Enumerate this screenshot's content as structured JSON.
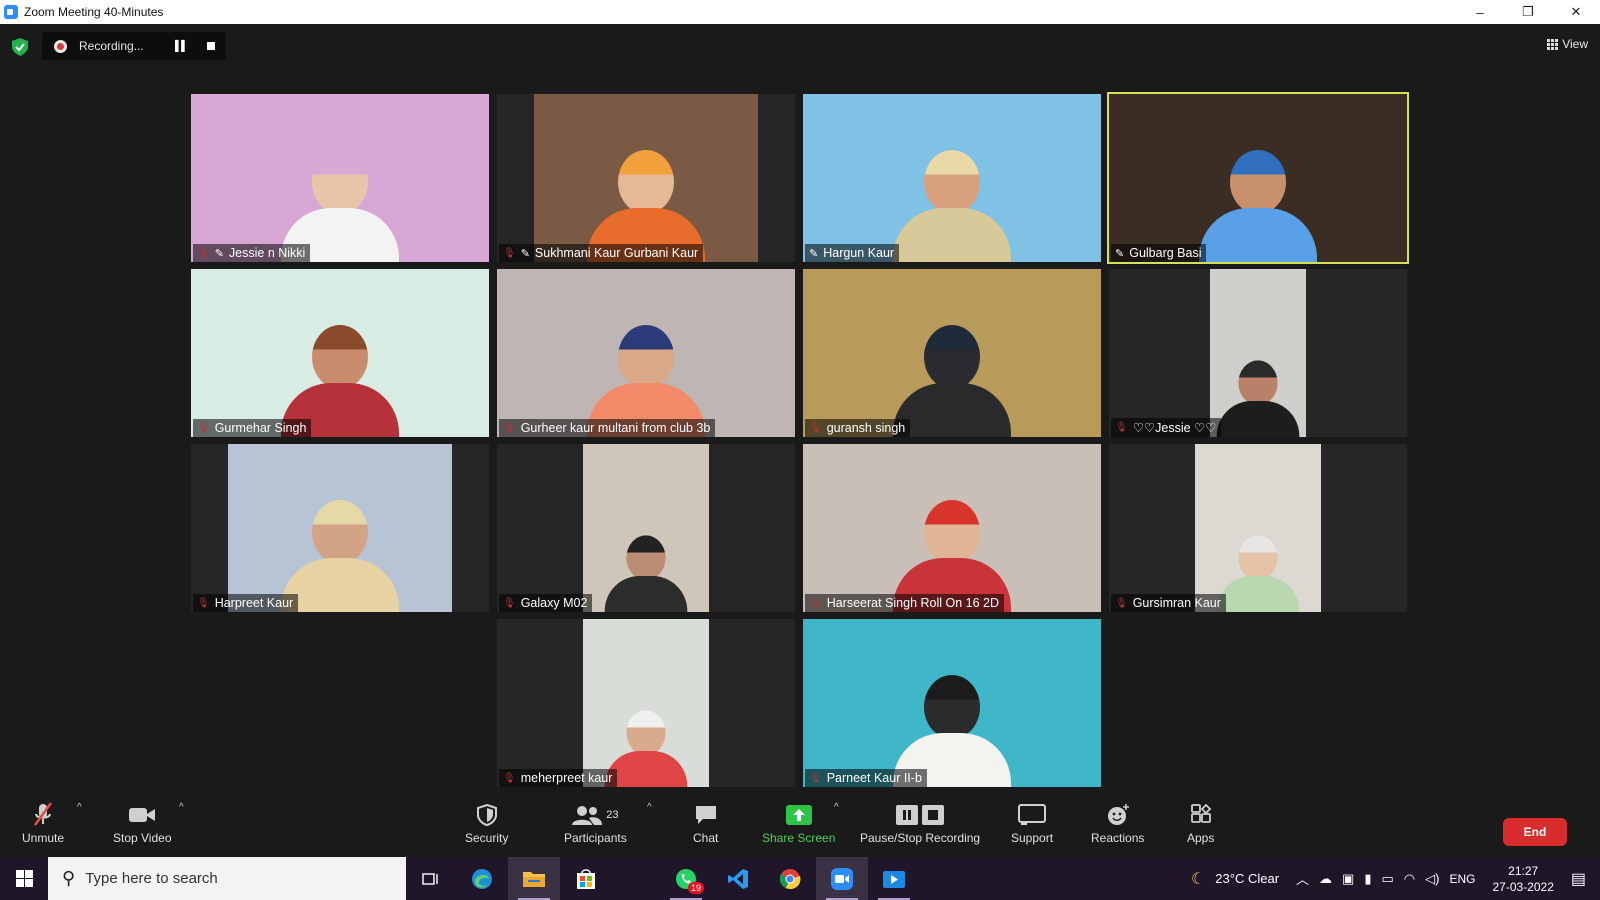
{
  "window": {
    "title": "Zoom Meeting 40-Minutes",
    "controls": [
      "–",
      "❐",
      "✕"
    ]
  },
  "meeting": {
    "recording_label": "Recording...",
    "view_label": "View",
    "participants": [
      {
        "name": "Jessie n Nikki",
        "muted": true,
        "pinned": true,
        "bg": "#d9a7d6"
      },
      {
        "name": "Sukhmani Kaur Gurbani Kaur",
        "muted": true,
        "pinned": true,
        "bg": "#7a5a45"
      },
      {
        "name": "Hargun Kaur",
        "muted": false,
        "pinned": true,
        "bg": "#7fc2e6"
      },
      {
        "name": "Gulbarg Basi",
        "muted": false,
        "pinned": true,
        "bg": "#3b2c24",
        "active_speaker": true
      },
      {
        "name": "Gurmehar Singh",
        "muted": true,
        "pinned": false,
        "bg": "#d8ece4"
      },
      {
        "name": "Gurheer kaur multani from club 3b",
        "muted": true,
        "pinned": false,
        "bg": "#bfb6b4"
      },
      {
        "name": "guransh singh",
        "muted": true,
        "pinned": false,
        "bg": "#b89a5a"
      },
      {
        "name": "♡♡Jessie ♡♡",
        "muted": true,
        "pinned": false,
        "bg": "#d0cfcc"
      },
      {
        "name": "Harpreet Kaur",
        "muted": true,
        "pinned": false,
        "bg": "#b6c4d6"
      },
      {
        "name": "Galaxy M02",
        "muted": true,
        "pinned": false,
        "bg": "#cfc5b8"
      },
      {
        "name": "Harseerat Singh Roll On 16 2D",
        "muted": true,
        "pinned": false,
        "bg": "#c9bfb7"
      },
      {
        "name": "Gursimran Kaur",
        "muted": true,
        "pinned": false,
        "bg": "#dcd8d2"
      },
      {
        "name": "meherpreet kaur",
        "muted": true,
        "pinned": false,
        "bg": "#d8ddd8"
      },
      {
        "name": "Parneet Kaur II-b",
        "muted": true,
        "pinned": false,
        "bg": "#3fb7c9"
      }
    ]
  },
  "toolbar": {
    "unmute": "Unmute",
    "stop_video": "Stop Video",
    "security": "Security",
    "participants": "Participants",
    "participants_count": "23",
    "chat": "Chat",
    "share_screen": "Share Screen",
    "pause_stop_recording": "Pause/Stop Recording",
    "support": "Support",
    "reactions": "Reactions",
    "apps": "Apps",
    "end": "End"
  },
  "taskbar": {
    "search_placeholder": "Type here to search",
    "whatsapp_badge": "19",
    "weather": "23°C  Clear",
    "language": "ENG",
    "time": "21:27",
    "date": "27-03-2022"
  },
  "colors": {
    "accent_green": "#4ccd5a",
    "active_speaker": "#d4e157",
    "end_red": "#d92d2d",
    "muted_red": "#e74c3c"
  }
}
